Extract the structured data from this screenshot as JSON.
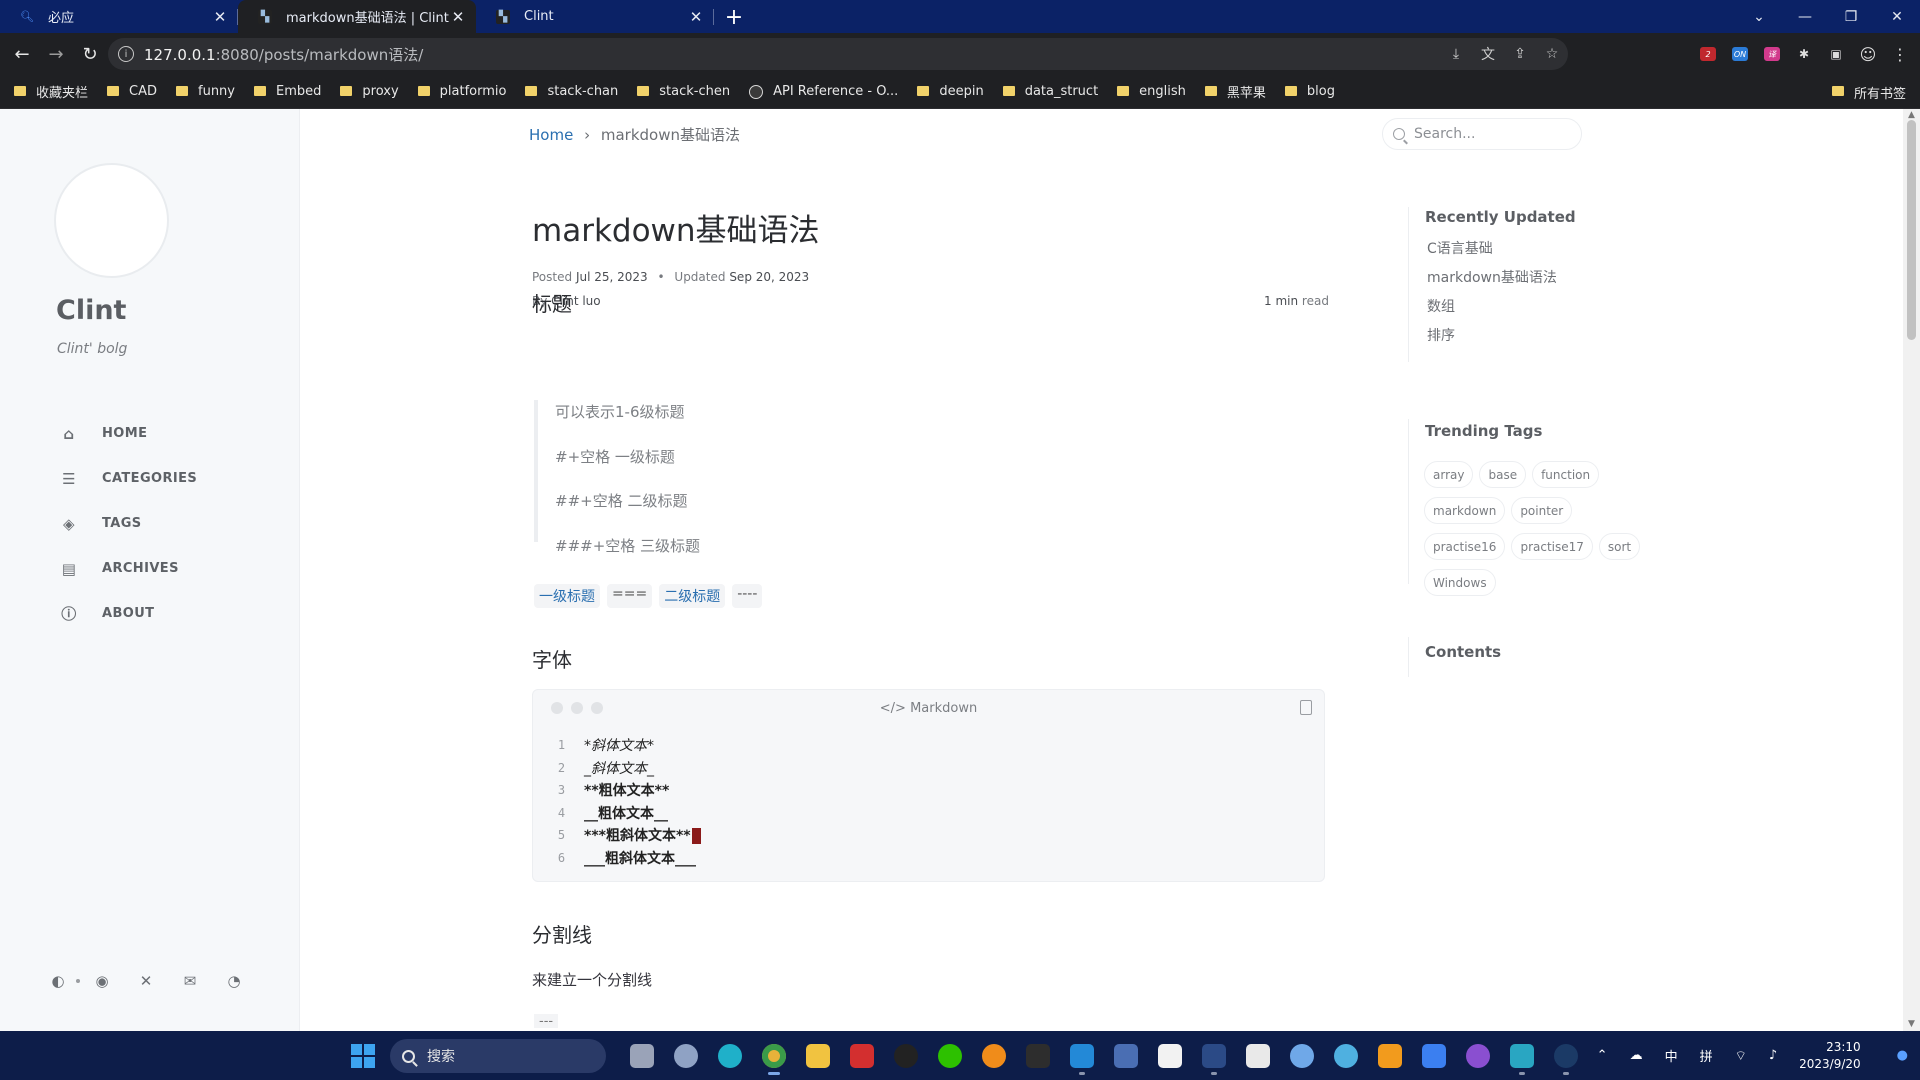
{
  "browser": {
    "tabs": [
      {
        "title": "必应",
        "icon": "bing-search-icon"
      },
      {
        "title": "markdown基础语法 | Clint",
        "icon": "site-favicon"
      },
      {
        "title": "Clint",
        "icon": "site-favicon"
      }
    ],
    "url_host": "127.0.0.1",
    "url_rest": ":8080/posts/markdown语法/",
    "bookmarks": [
      "收藏夹栏",
      "CAD",
      "funny",
      "Embed",
      "proxy",
      "platformio",
      "stack-chan",
      "stack-chen",
      "API Reference - O...",
      "deepin",
      "data_struct",
      "english",
      "黑苹果",
      "blog"
    ],
    "bookmarks_right": "所有书签",
    "extension_badges": [
      "2",
      "ON",
      "译"
    ]
  },
  "sidebar": {
    "title": "Clint",
    "subtitle": "Clint' bolg",
    "nav": [
      {
        "label": "HOME",
        "icon": "home-icon"
      },
      {
        "label": "CATEGORIES",
        "icon": "categories-icon"
      },
      {
        "label": "TAGS",
        "icon": "tags-icon"
      },
      {
        "label": "ARCHIVES",
        "icon": "archive-icon"
      },
      {
        "label": "ABOUT",
        "icon": "info-icon"
      }
    ]
  },
  "breadcrumb": {
    "home": "Home",
    "sep": "›",
    "current": "markdown基础语法"
  },
  "search": {
    "placeholder": "Search..."
  },
  "post": {
    "title": "markdown基础语法",
    "posted_label": "Posted",
    "posted_date": "Jul 25, 2023",
    "bullet": "•",
    "updated_label": "Updated",
    "updated_date": "Sep 20, 2023",
    "by_label": "By",
    "author": "Clint luo",
    "read_num": "1 min",
    "read_label": "read",
    "h2_1": "标题",
    "quote": [
      "可以表示1-6级标题",
      "#+空格 一级标题",
      "##+空格 二级标题",
      "###+空格 三级标题"
    ],
    "inline": [
      "一级标题",
      "===",
      "二级标题",
      "----"
    ],
    "h2_2": "字体",
    "code_lang": "Markdown",
    "code_lines": [
      "*斜体文本*",
      "_斜体文本_",
      "**粗体文本**",
      "__粗体文本__",
      "***粗斜体文本**",
      "___粗斜体文本___"
    ],
    "h2_3": "分割线",
    "para": "来建立一个分割线",
    "hr_code": "---"
  },
  "panel": {
    "recent_title": "Recently Updated",
    "recent": [
      "C语言基础",
      "markdown基础语法",
      "数组",
      "排序"
    ],
    "tags_title": "Trending Tags",
    "tags": [
      "array",
      "base",
      "function",
      "markdown",
      "pointer",
      "practise16",
      "practise17",
      "sort",
      "Windows"
    ],
    "contents_title": "Contents"
  },
  "taskbar": {
    "search": "搜索",
    "ime1": "中",
    "ime2": "拼",
    "time": "23:10",
    "date": "2023/9/20"
  }
}
